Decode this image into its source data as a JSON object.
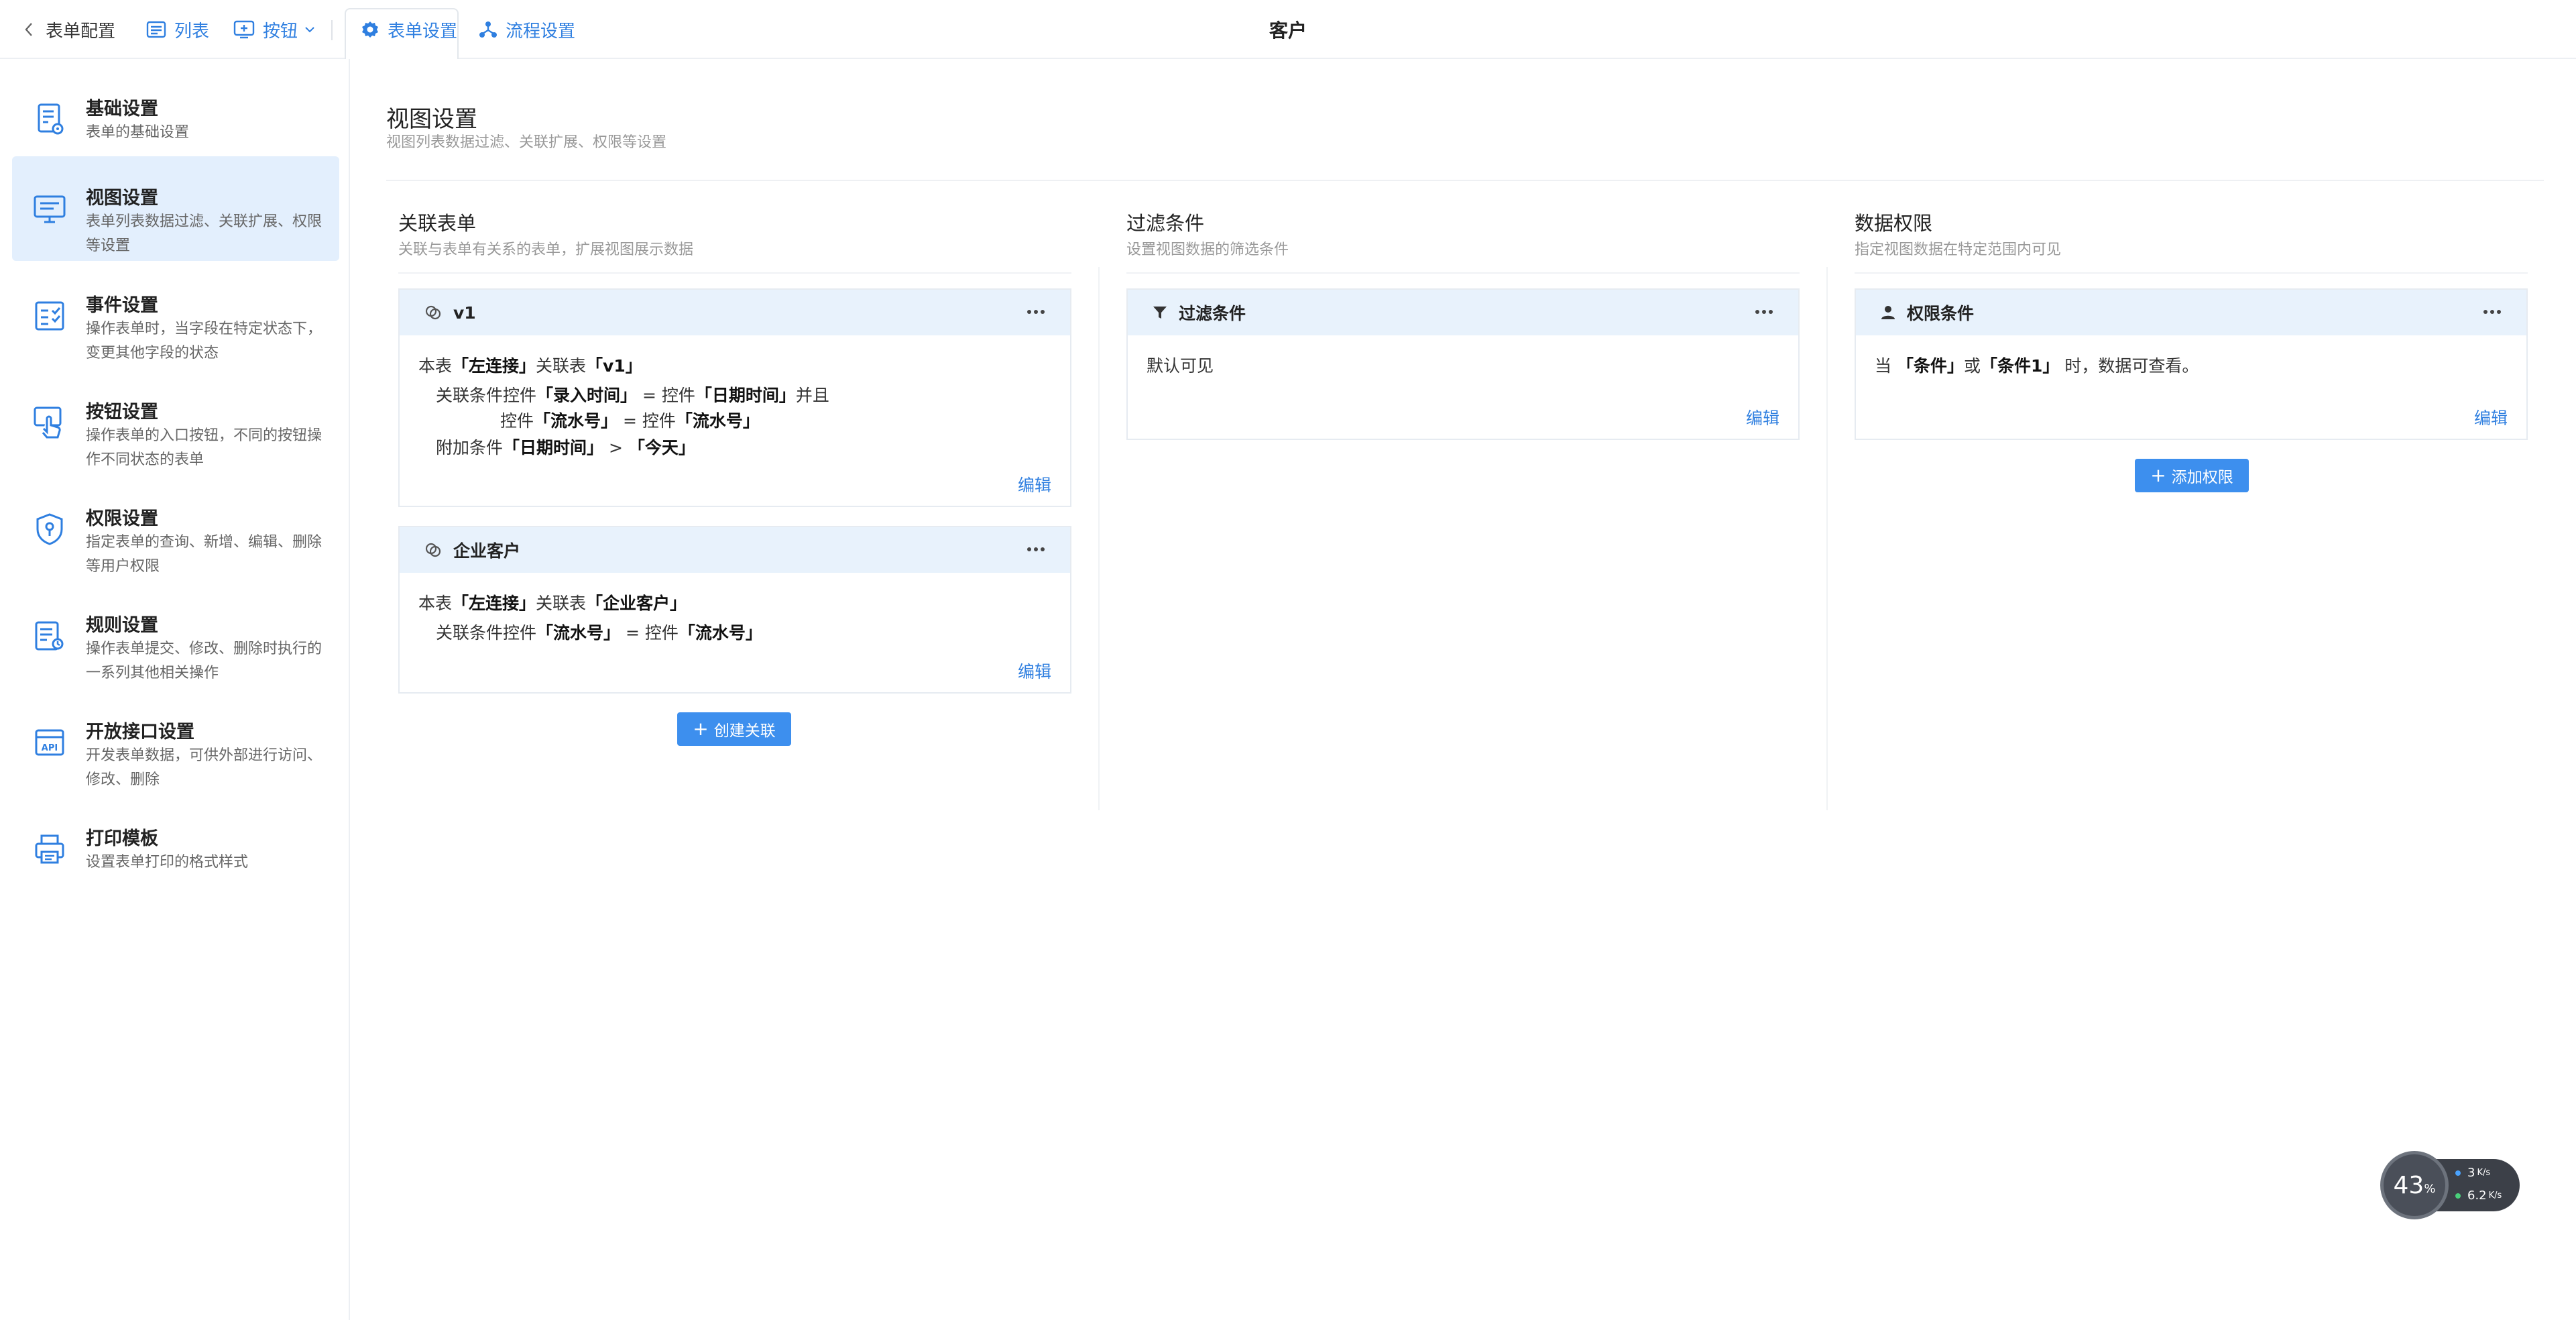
{
  "topbar": {
    "back_label": "表单配置",
    "list_label": "列表",
    "button_label": "按钮",
    "form_settings_label": "表单设置",
    "flow_settings_label": "流程设置",
    "title": "客户"
  },
  "sidebar": {
    "items": [
      {
        "title": "基础设置",
        "desc": "表单的基础设置",
        "icon": "form-doc-icon"
      },
      {
        "title": "视图设置",
        "desc": "表单列表数据过滤、关联扩展、权限等设置",
        "icon": "monitor-icon",
        "active": true
      },
      {
        "title": "事件设置",
        "desc": "操作表单时，当字段在特定状态下，变更其他字段的状态",
        "icon": "event-icon"
      },
      {
        "title": "按钮设置",
        "desc": "操作表单的入口按钮，不同的按钮操作不同状态的表单",
        "icon": "hand-click-icon"
      },
      {
        "title": "权限设置",
        "desc": "指定表单的查询、新增、编辑、删除等用户权限",
        "icon": "shield-icon"
      },
      {
        "title": "规则设置",
        "desc": "操作表单提交、修改、删除时执行的一系列其他相关操作",
        "icon": "rule-icon"
      },
      {
        "title": "开放接口设置",
        "desc": "开发表单数据，可供外部进行访问、修改、删除",
        "icon": "api-icon"
      },
      {
        "title": "打印模板",
        "desc": "设置表单打印的格式样式",
        "icon": "printer-icon"
      }
    ]
  },
  "main": {
    "title": "视图设置",
    "subtitle": "视图列表数据过滤、关联扩展、权限等设置"
  },
  "relations": {
    "title": "关联表单",
    "subtitle": "关联与表单有关系的表单，扩展视图展示数据",
    "cards": [
      {
        "name": "v1",
        "lines": [
          {
            "t1": "本表",
            "b1": "「左连接」",
            "t2": "关联表",
            "b2": "「v1」"
          },
          {
            "t1": "关联条件控件",
            "b1": "「录入时间」",
            "t2": " = 控件",
            "b2": "「日期时间」",
            "t3": "并且"
          },
          {
            "t1": "控件",
            "b1": "「流水号」",
            "t2": " = 控件",
            "b2": "「流水号」"
          },
          {
            "t1": "附加条件",
            "b1": "「日期时间」",
            "t2": " > ",
            "b2": "「今天」"
          }
        ],
        "edit_label": "编辑"
      },
      {
        "name": "企业客户",
        "lines": [
          {
            "t1": "本表",
            "b1": "「左连接」",
            "t2": "关联表",
            "b2": "「企业客户」"
          },
          {
            "t1": "关联条件控件",
            "b1": "「流水号」",
            "t2": " = 控件",
            "b2": "「流水号」"
          }
        ],
        "edit_label": "编辑"
      }
    ],
    "create_label": "创建关联"
  },
  "filters": {
    "title": "过滤条件",
    "subtitle": "设置视图数据的筛选条件",
    "card_title": "过滤条件",
    "text": "默认可见",
    "edit_label": "编辑"
  },
  "permissions": {
    "title": "数据权限",
    "subtitle": "指定视图数据在特定范围内可见",
    "card_title": "权限条件",
    "t1": "当",
    "b1": "「条件」",
    "t2": "或",
    "b2": "「条件1」",
    "t3": "时，数据可查看。",
    "edit_label": "编辑",
    "add_label": "添加权限"
  },
  "widget": {
    "percent": "43",
    "percent_unit": "%",
    "up": "3",
    "up_unit": "K/s",
    "down": "6.2",
    "down_unit": "K/s"
  },
  "colors": {
    "accent": "#2f7fe0",
    "button": "#3d8fee",
    "active_bg": "#e3effd",
    "card_head_bg": "#e8f2fc"
  }
}
